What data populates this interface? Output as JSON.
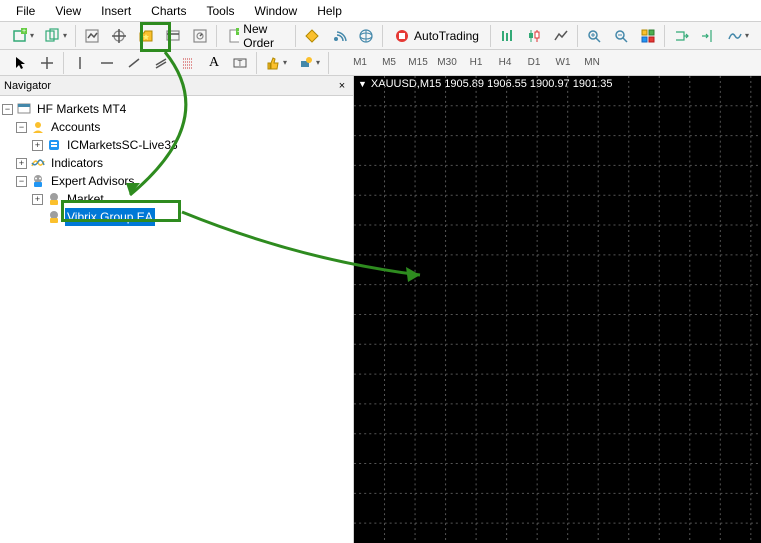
{
  "menu": {
    "items": [
      "File",
      "View",
      "Insert",
      "Charts",
      "Tools",
      "Window",
      "Help"
    ]
  },
  "toolbar1": {
    "new_order_label": "New Order",
    "autotrading_label": "AutoTrading"
  },
  "timeframes": [
    "M1",
    "M5",
    "M15",
    "M30",
    "H1",
    "H4",
    "D1",
    "W1",
    "MN"
  ],
  "navigator": {
    "title": "Navigator",
    "root": "HF Markets MT4",
    "accounts_label": "Accounts",
    "account_item": "ICMarketsSC-Live33",
    "indicators_label": "Indicators",
    "ea_label": "Expert Advisors",
    "market_label": "Market",
    "selected_ea": "Vibrix Group EA"
  },
  "chart": {
    "symbol_info": "XAUUSD,M15 1905.89 1906.55 1900.97 1901.35"
  }
}
